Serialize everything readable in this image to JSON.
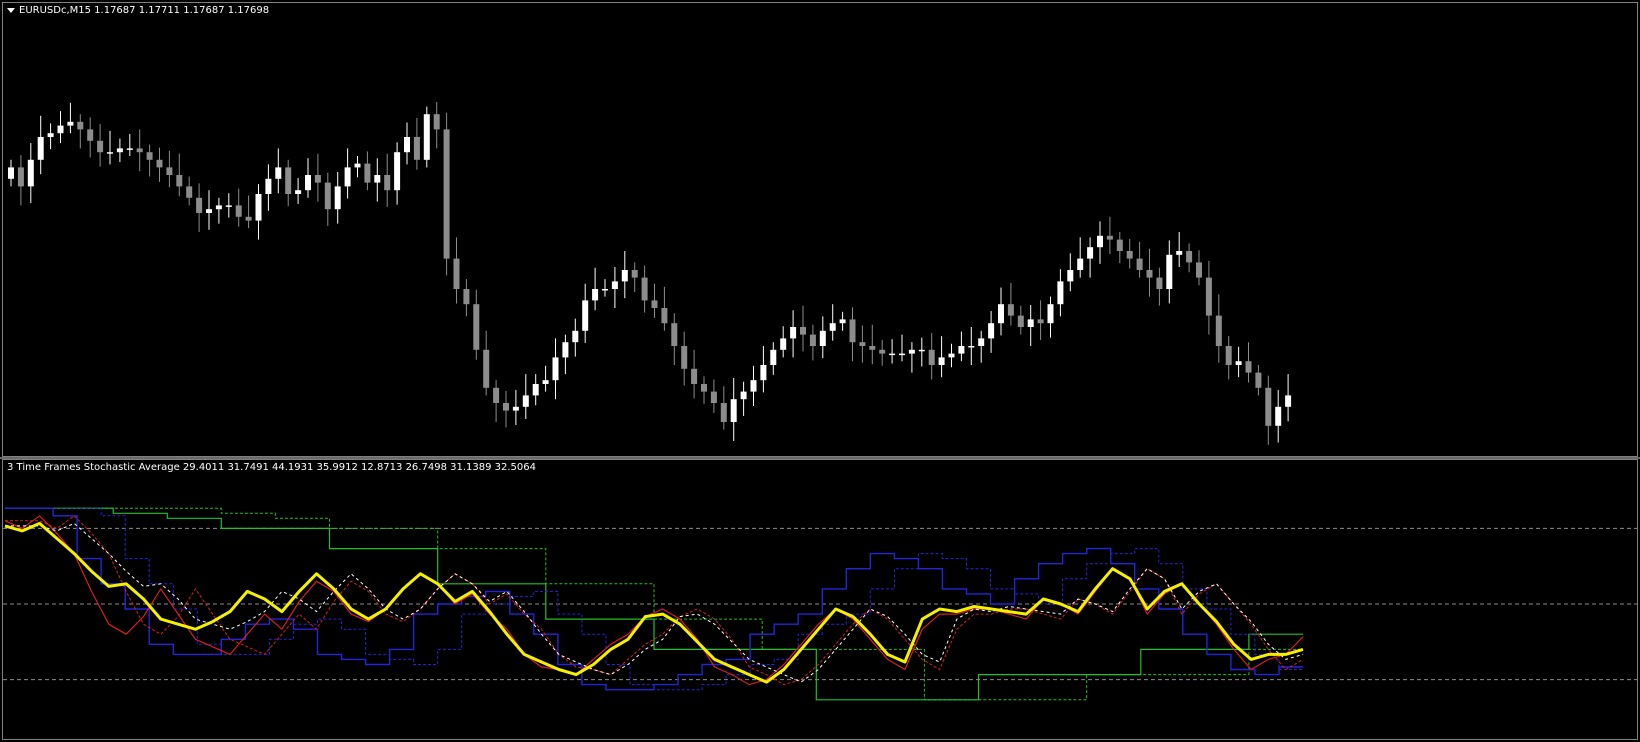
{
  "main_chart": {
    "symbol_line": "EURUSDc,M15  1.17687 1.17711 1.17687 1.17698"
  },
  "indicator": {
    "label": "3 Time Frames Stochastic Average 29.4011 31.7491 44.1931 35.9912 12.8713 26.7498 31.1389 32.5064",
    "levels": [
      80,
      50,
      20
    ],
    "colors": {
      "fast": "#d42020",
      "medium": "#2424d8",
      "slow": "#22c022",
      "average": "#f5f000",
      "average_signal": "#ffffff",
      "levels": "#8c8c8c"
    }
  },
  "colors": {
    "background": "#000000",
    "bull_candle": "#ffffff",
    "bear_candle": "#8c8c8c",
    "border": "#808080"
  },
  "chart_data": [
    {
      "type": "candlestick",
      "symbol": "EURUSDc",
      "timeframe": "M15",
      "last_bar": {
        "open": 1.17687,
        "high": 1.17711,
        "low": 1.17687,
        "close": 1.17698
      },
      "closes": [
        0.62,
        0.57,
        0.64,
        0.7,
        0.71,
        0.73,
        0.74,
        0.72,
        0.69,
        0.66,
        0.66,
        0.67,
        0.67,
        0.66,
        0.64,
        0.62,
        0.6,
        0.57,
        0.54,
        0.5,
        0.51,
        0.52,
        0.52,
        0.49,
        0.48,
        0.55,
        0.59,
        0.62,
        0.55,
        0.56,
        0.6,
        0.58,
        0.51,
        0.57,
        0.62,
        0.63,
        0.58,
        0.6,
        0.56,
        0.66,
        0.7,
        0.64,
        0.76,
        0.72,
        0.38,
        0.3,
        0.26,
        0.14,
        0.04,
        0.0,
        -0.02,
        -0.01,
        0.02,
        0.05,
        0.06,
        0.12,
        0.16,
        0.19,
        0.27,
        0.3,
        0.3,
        0.32,
        0.35,
        0.33,
        0.27,
        0.25,
        0.21,
        0.15,
        0.09,
        0.05,
        0.03,
        0.0,
        -0.05,
        0.01,
        0.03,
        0.06,
        0.1,
        0.14,
        0.17,
        0.2,
        0.18,
        0.15,
        0.19,
        0.21,
        0.22,
        0.16,
        0.15,
        0.14,
        0.13,
        0.13,
        0.13,
        0.14,
        0.14,
        0.1,
        0.12,
        0.13,
        0.15,
        0.15,
        0.17,
        0.21,
        0.26,
        0.23,
        0.2,
        0.22,
        0.21,
        0.26,
        0.32,
        0.35,
        0.38,
        0.41,
        0.44,
        0.43,
        0.4,
        0.38,
        0.35,
        0.33,
        0.3,
        0.39,
        0.4,
        0.37,
        0.33,
        0.23,
        0.15,
        0.1,
        0.11,
        0.08,
        0.04,
        -0.06,
        -0.01,
        0.02
      ]
    },
    {
      "type": "line",
      "title": "3 Time Frames Stochastic Average",
      "ylim": [
        0,
        100
      ],
      "levels": [
        80,
        50,
        20
      ],
      "last_values": [
        29.4011,
        31.7491,
        44.1931,
        35.9912,
        12.8713,
        26.7498,
        31.1389,
        32.5064
      ],
      "series": [
        {
          "values": [
            83,
            80,
            85,
            78,
            70,
            55,
            42,
            38,
            45,
            56,
            46,
            36,
            33,
            30,
            38,
            46,
            40,
            51,
            59,
            55,
            46,
            43,
            48,
            56,
            62,
            58,
            50,
            54,
            46,
            40,
            30,
            25,
            24,
            22,
            28,
            34,
            38,
            45,
            48,
            44,
            36,
            25,
            22,
            18,
            20,
            26,
            34,
            42,
            48,
            44,
            36,
            28,
            24,
            40,
            46,
            46,
            48,
            48,
            46,
            44,
            52,
            50,
            46,
            55,
            64,
            60,
            46,
            54,
            58,
            50,
            42,
            32,
            24,
            28,
            30,
            37
          ]
        },
        {
          "values": [
            88,
            88,
            85,
            68,
            58,
            48,
            34,
            30,
            30,
            36,
            42,
            44,
            40,
            30,
            28,
            26,
            32,
            46,
            50,
            53,
            55,
            46,
            38,
            26,
            18,
            16,
            16,
            18,
            22,
            26,
            28,
            38,
            42,
            46,
            56,
            64,
            70,
            68,
            64,
            56,
            54,
            50,
            60,
            66,
            70,
            72,
            66,
            56,
            48,
            38,
            30,
            24,
            22,
            25
          ]
        },
        {
          "values": [
            88,
            88,
            86,
            84,
            80,
            80,
            72,
            72,
            58,
            58,
            44,
            44,
            32,
            32,
            32,
            12,
            12,
            12,
            22,
            22,
            22,
            32,
            32,
            38
          ]
        },
        {
          "values": [
            81,
            79,
            82,
            76,
            70,
            63,
            57,
            58,
            52,
            44,
            42,
            40,
            43,
            47,
            55,
            52,
            47,
            55,
            62,
            56,
            48,
            44,
            48,
            56,
            62,
            58,
            51,
            55,
            47,
            38,
            30,
            27,
            24,
            22,
            26,
            32,
            36,
            45,
            46,
            42,
            35,
            28,
            25,
            22,
            19,
            24,
            32,
            40,
            48,
            45,
            38,
            30,
            27,
            44,
            48,
            47,
            49,
            48,
            47,
            46,
            52,
            50,
            47,
            56,
            64,
            60,
            48,
            55,
            58,
            50,
            43,
            34,
            28,
            30,
            30,
            32
          ]
        }
      ]
    }
  ]
}
